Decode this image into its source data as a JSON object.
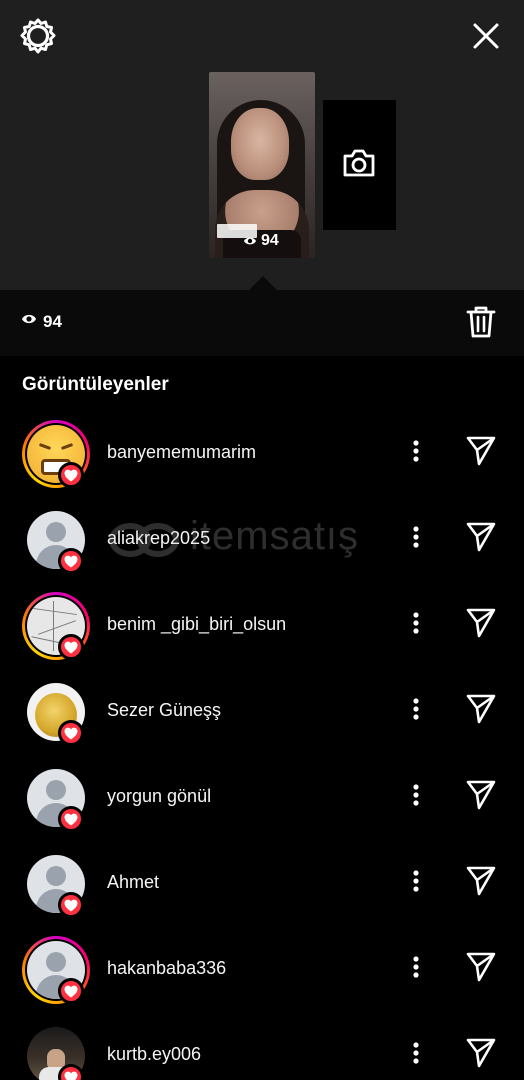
{
  "header": {
    "settings_icon": "gear-icon",
    "close_icon": "close-icon"
  },
  "story": {
    "view_count": "94",
    "add_icon": "camera-icon"
  },
  "stats_bar": {
    "view_count": "94",
    "delete_icon": "trash-icon"
  },
  "section_title": "Görüntüleyenler",
  "watermark": "itemsatış",
  "viewers": [
    {
      "username": "banyememumarim",
      "avatar": "emoji",
      "ring": true,
      "liked": true
    },
    {
      "username": "aliakrep2025",
      "avatar": "default",
      "ring": false,
      "liked": true
    },
    {
      "username": "benim _gibi_biri_olsun",
      "avatar": "map",
      "ring": true,
      "liked": true
    },
    {
      "username": "Sezer Güneşş",
      "avatar": "coin",
      "ring": false,
      "liked": true
    },
    {
      "username": "yorgun gönül",
      "avatar": "default",
      "ring": false,
      "liked": true
    },
    {
      "username": "Ahmet",
      "avatar": "default",
      "ring": false,
      "liked": true
    },
    {
      "username": "hakanbaba336",
      "avatar": "default",
      "ring": true,
      "liked": true
    },
    {
      "username": "kurtb.ey006",
      "avatar": "photo",
      "ring": false,
      "liked": true
    }
  ],
  "colors": {
    "like_badge": "#ff3040",
    "top_background": "#1f1f1f",
    "list_background": "#000000"
  }
}
